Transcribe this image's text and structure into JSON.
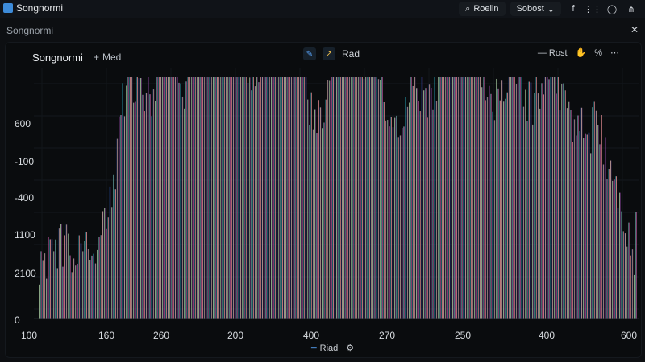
{
  "window": {
    "title": "Songnormi",
    "subtitle": "Songnormi",
    "controls": [
      {
        "label": "Roelin",
        "icon": "search-icon"
      },
      {
        "label": "Sobost",
        "icon": "chevron-down-icon"
      }
    ],
    "icons": [
      "function-icon",
      "settings-icon",
      "power-icon",
      "apps-icon",
      "close-icon"
    ]
  },
  "panel": {
    "title": "Songnormi",
    "add_label": "Med",
    "tool_label": "Rad",
    "right_tools": [
      {
        "label": "Rost",
        "icon": "minus-icon"
      },
      {
        "label": "",
        "icon": "hand-icon"
      },
      {
        "label": "%",
        "icon": "percent-icon"
      },
      {
        "label": "",
        "icon": "more-icon"
      }
    ],
    "footer": {
      "label": "Riad",
      "icon": "gear-icon"
    }
  },
  "chart_data": {
    "type": "bar",
    "y_ticks": [
      "600",
      "-100",
      "-400",
      "1100",
      "2100",
      "0"
    ],
    "x_ticks": [
      "100",
      "160",
      "260",
      "200",
      "400",
      "270",
      "250",
      "400",
      "600"
    ]
  },
  "colors": {
    "accent": "#3d8bd9",
    "spectrum_start": "#2e5fd4",
    "spectrum_mid": "#f1b340",
    "spectrum_end": "#a25be1"
  }
}
